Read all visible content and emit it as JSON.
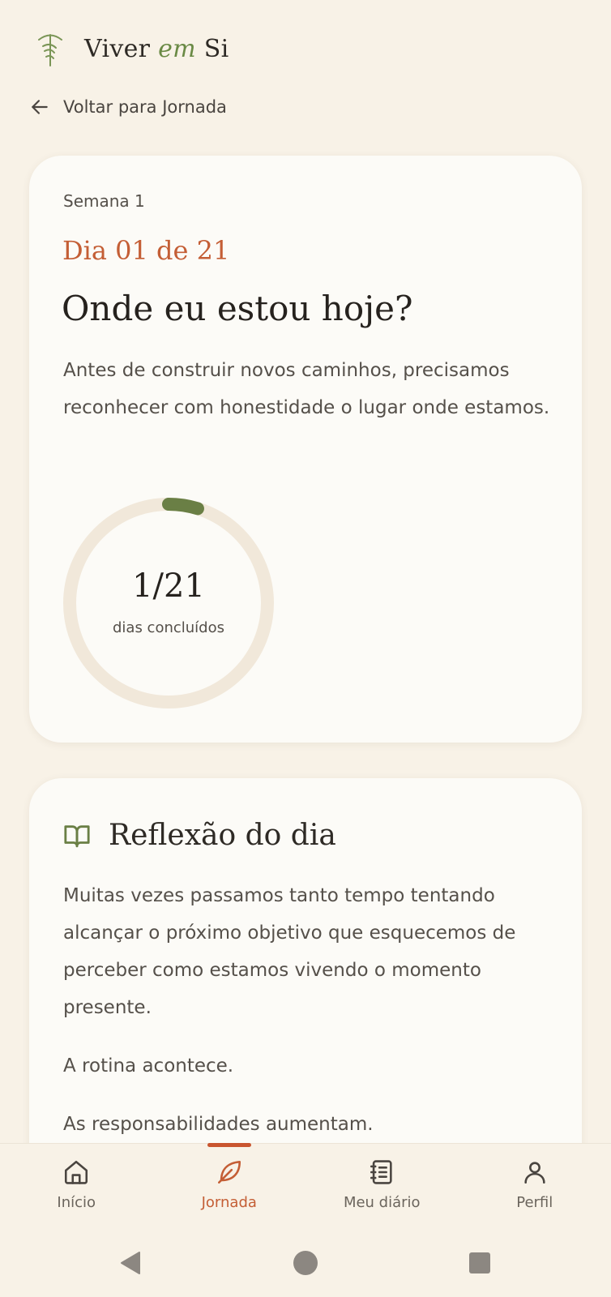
{
  "app": {
    "brand_main": "Viver ",
    "brand_accent": "em",
    "brand_end": " Si"
  },
  "back": {
    "label": "Voltar para Jornada"
  },
  "day_card": {
    "week": "Semana 1",
    "day": "Dia 01 de 21",
    "title": "Onde eu estou hoje?",
    "description": "Antes de construir novos caminhos, precisamos reconhecer com honestidade o lugar onde estamos.",
    "progress": {
      "count_text": "1/21",
      "label": "dias concluídos",
      "completed": 1,
      "total": 21
    }
  },
  "reflection": {
    "title": "Reflexão do dia",
    "paragraphs": [
      "Muitas vezes passamos tanto tempo tentando alcançar o próximo objetivo que esquecemos de perceber como estamos vivendo o momento presente.",
      "A rotina acontece.",
      "As responsabilidades aumentam."
    ]
  },
  "nav": {
    "items": [
      {
        "label": "Início",
        "icon": "home-icon",
        "active": false
      },
      {
        "label": "Jornada",
        "icon": "leaf-icon",
        "active": true
      },
      {
        "label": "Meu diário",
        "icon": "notebook-icon",
        "active": false
      },
      {
        "label": "Perfil",
        "icon": "user-icon",
        "active": false
      }
    ]
  },
  "colors": {
    "background": "#f8f2e7",
    "card": "#fcfbf7",
    "accent": "#c45e35",
    "green": "#6a7f45",
    "ring_track": "#f1e8da"
  },
  "system_nav": [
    "back-triangle-icon",
    "home-circle-icon",
    "recents-square-icon"
  ]
}
